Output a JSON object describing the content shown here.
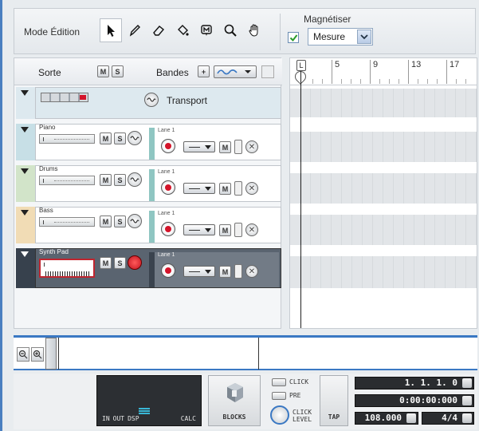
{
  "toolbar": {
    "mode_label": "Mode Édition",
    "tools": [
      "arrow-icon",
      "pencil-icon",
      "eraser-icon",
      "paint-bucket-icon",
      "marker-icon",
      "magnifier-icon",
      "hand-icon"
    ],
    "magnet_label": "Magnétiser",
    "magnet_checked": true,
    "magnet_value": "Mesure"
  },
  "track_header": {
    "sorte_label": "Sorte",
    "m_label": "M",
    "s_label": "S",
    "bandes_label": "Bandes",
    "bandes_add_label": "+"
  },
  "tracks": {
    "transport": {
      "name": "Transport"
    },
    "piano": {
      "name": "Piano",
      "lane": "Lane 1"
    },
    "drums": {
      "name": "Drums",
      "lane": "Lane 1"
    },
    "bass": {
      "name": "Bass",
      "lane": "Lane 1"
    },
    "synth": {
      "name": "Synth Pad",
      "lane": "Lane 1"
    }
  },
  "button_labels": {
    "m": "M",
    "s": "S"
  },
  "ruler": {
    "labels": [
      "5",
      "9",
      "13",
      "17"
    ]
  },
  "bottom": {
    "dsp_labels": [
      "IN",
      "OUT",
      "DSP"
    ],
    "calc_label": "CALC",
    "blocks_label": "BLOCKS",
    "click_label": "CLICK",
    "pre_label": "PRE",
    "click_level_label_1": "CLICK",
    "click_level_label_2": "LEVEL",
    "tap_label": "TAP",
    "bars_value": "1. 1. 1.   0",
    "time_value": "0:00:00:000",
    "tempo_value": "108.000",
    "signature_value": "4/4"
  },
  "colors": {
    "accent": "#3a78c3",
    "record_red": "#d3142a",
    "lane_color": "#8fc6c2"
  }
}
